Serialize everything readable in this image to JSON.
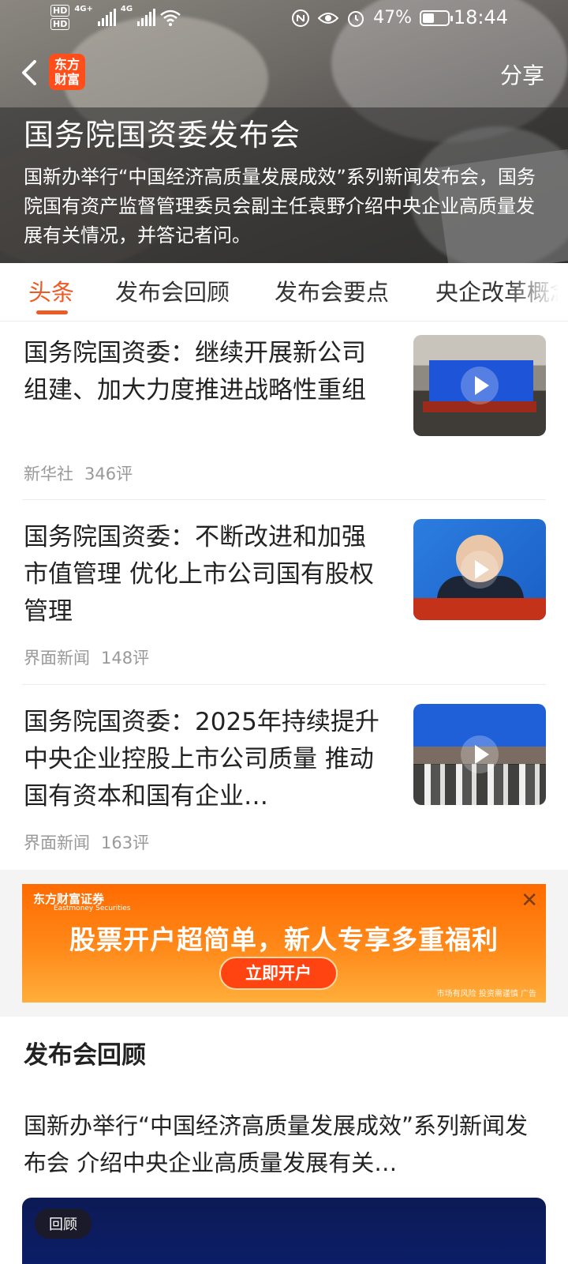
{
  "status_bar": {
    "hd1": "HD",
    "hd2": "HD",
    "net1": "4G+",
    "net2": "4G",
    "battery": "47%",
    "battery_level": 0.47,
    "time": "18:44"
  },
  "header": {
    "logo_line1": "东方",
    "logo_line2": "财富",
    "share": "分享"
  },
  "hero": {
    "title": "国务院国资委发布会",
    "description": "国新办举行“中国经济高质量发展成效”系列新闻发布会，国务院国有资产监督管理委员会副主任袁野介绍中央企业高质量发展有关情况，并答记者问。"
  },
  "tabs": [
    {
      "label": "头条",
      "active": true
    },
    {
      "label": "发布会回顾",
      "active": false
    },
    {
      "label": "发布会要点",
      "active": false
    },
    {
      "label": "央企改革概念",
      "active": false
    }
  ],
  "news": [
    {
      "title": "国务院国资委：继续开展新公司组建、加大力度推进战略性重组",
      "source": "新华社",
      "comments": "346评"
    },
    {
      "title": "国务院国资委：不断改进和加强市值管理 优化上市公司国有股权管理",
      "source": "界面新闻",
      "comments": "148评"
    },
    {
      "title": "国务院国资委：2025年持续提升中央企业控股上市公司质量 推动国有资本和国有企业…",
      "source": "界面新闻",
      "comments": "163评"
    }
  ],
  "ad": {
    "brand": "东方财富证券",
    "brand_en": "Eastmoney Securities",
    "headline": "股票开户超简单，新人专享多重福利",
    "button": "立即开户",
    "risk": "市场有风险 投资需谨慎 广告"
  },
  "review": {
    "title": "发布会回顾",
    "description": "国新办举行“中国经济高质量发展成效”系列新闻发布会 介绍中央企业高质量发展有关…",
    "badge": "回顾"
  }
}
